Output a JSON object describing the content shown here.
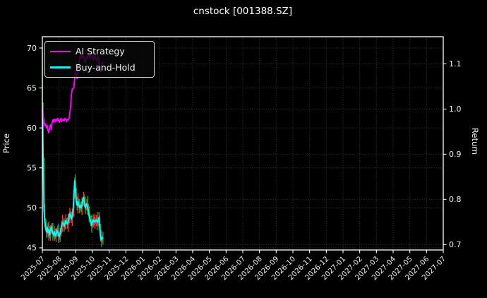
{
  "title": "cnstock [001388.SZ]",
  "colors": {
    "background": "#000000",
    "text": "#f2f2f2",
    "spine": "#ffffff",
    "grid": "#3f3f3f",
    "ai_strategy": "#ff00ff",
    "buy_and_hold": "#00ffff",
    "candle_up": "#ff3030",
    "candle_down": "#00aa44",
    "legend_border": "#d9d9d9"
  },
  "chart_data": {
    "type": "line",
    "title": "cnstock [001388.SZ]",
    "legend": {
      "position": "upper left",
      "entries": [
        "AI Strategy",
        "Buy-and-Hold"
      ]
    },
    "left_axis": {
      "label": "Price",
      "ticks": [
        70,
        65,
        60,
        55,
        50,
        45
      ],
      "lim": [
        44.73,
        71.41
      ]
    },
    "right_axis": {
      "label": "Return",
      "ticks": [
        1.1,
        1.0,
        0.9,
        0.8,
        0.7
      ],
      "lim": [
        0.688,
        1.16
      ]
    },
    "x_axis": {
      "months_span": 24,
      "tick_labels": [
        "2025-07",
        "2025-08",
        "2025-09",
        "2025-10",
        "2025-11",
        "2025-12",
        "2026-01",
        "2026-02",
        "2026-03",
        "2026-04",
        "2026-05",
        "2026-06",
        "2026-07",
        "2026-08",
        "2026-09",
        "2026-10",
        "2026-11",
        "2026-12",
        "2027-01",
        "2027-02",
        "2027-03",
        "2027-04",
        "2027-05",
        "2027-06",
        "2027-07"
      ],
      "tick_rotation_deg": 45,
      "grid": true
    },
    "data_span_months": 3.63,
    "series": [
      {
        "name": "AI Strategy",
        "color": "#ff00ff",
        "axis": "left",
        "values": [
          62.3,
          61.5,
          60.8,
          60.3,
          60.5,
          60.0,
          60.3,
          59.7,
          59.4,
          60.0,
          60.4,
          59.8,
          60.6,
          61.0,
          60.7,
          61.1,
          60.8,
          61.1,
          60.9,
          61.2,
          60.9,
          60.7,
          61.0,
          61.2,
          60.8,
          61.0,
          61.1,
          60.9,
          61.2,
          61.0,
          60.8,
          61.1,
          61.0,
          61.2,
          61.8,
          62.8,
          64.2,
          64.9,
          64.9,
          65.1,
          66.2,
          67.3,
          66.5,
          66.2,
          67.0,
          68.0,
          68.6,
          69.0,
          68.7,
          69.2,
          68.8,
          69.0,
          68.5,
          68.2,
          68.6,
          69.0,
          68.7,
          69.3,
          69.0,
          68.6,
          68.9,
          69.1,
          68.8,
          68.5,
          68.8,
          69.0,
          68.7,
          68.4,
          68.7,
          68.9,
          68.3,
          67.6,
          67.0,
          67.4,
          67.9,
          68.3
        ]
      },
      {
        "name": "Buy-and-Hold",
        "color": "#00ffff",
        "axis": "left",
        "values": [
          62.3,
          56.0,
          49.8,
          48.3,
          47.6,
          47.0,
          47.5,
          46.9,
          47.3,
          46.6,
          47.1,
          47.6,
          47.2,
          46.8,
          46.6,
          47.0,
          46.5,
          46.7,
          47.2,
          47.0,
          46.6,
          46.4,
          46.8,
          47.3,
          47.9,
          48.2,
          48.0,
          47.7,
          48.1,
          48.4,
          48.2,
          48.0,
          48.3,
          48.8,
          49.3,
          49.0,
          48.6,
          49.0,
          49.6,
          51.5,
          53.4,
          52.2,
          50.8,
          50.3,
          50.8,
          50.4,
          50.0,
          50.3,
          50.0,
          50.4,
          51.0,
          51.3,
          50.6,
          50.0,
          50.3,
          50.5,
          50.1,
          49.5,
          48.9,
          48.5,
          48.2,
          47.8,
          48.3,
          48.5,
          48.2,
          48.4,
          48.3,
          48.5,
          48.2,
          48.4,
          48.8,
          47.5,
          46.3,
          46.0,
          46.3,
          46.1
        ]
      },
      {
        "name": "price-hilo-bars",
        "type": "hilo-bars",
        "axis": "left",
        "first_open": 70.0,
        "up_color": "#ff3030",
        "down_color": "#00aa44",
        "wick_pattern": [
          0.5,
          0.9,
          0.3,
          0.7,
          0.4,
          0.8,
          0.3,
          0.6,
          1.0,
          0.4,
          0.7,
          0.3
        ]
      }
    ]
  }
}
